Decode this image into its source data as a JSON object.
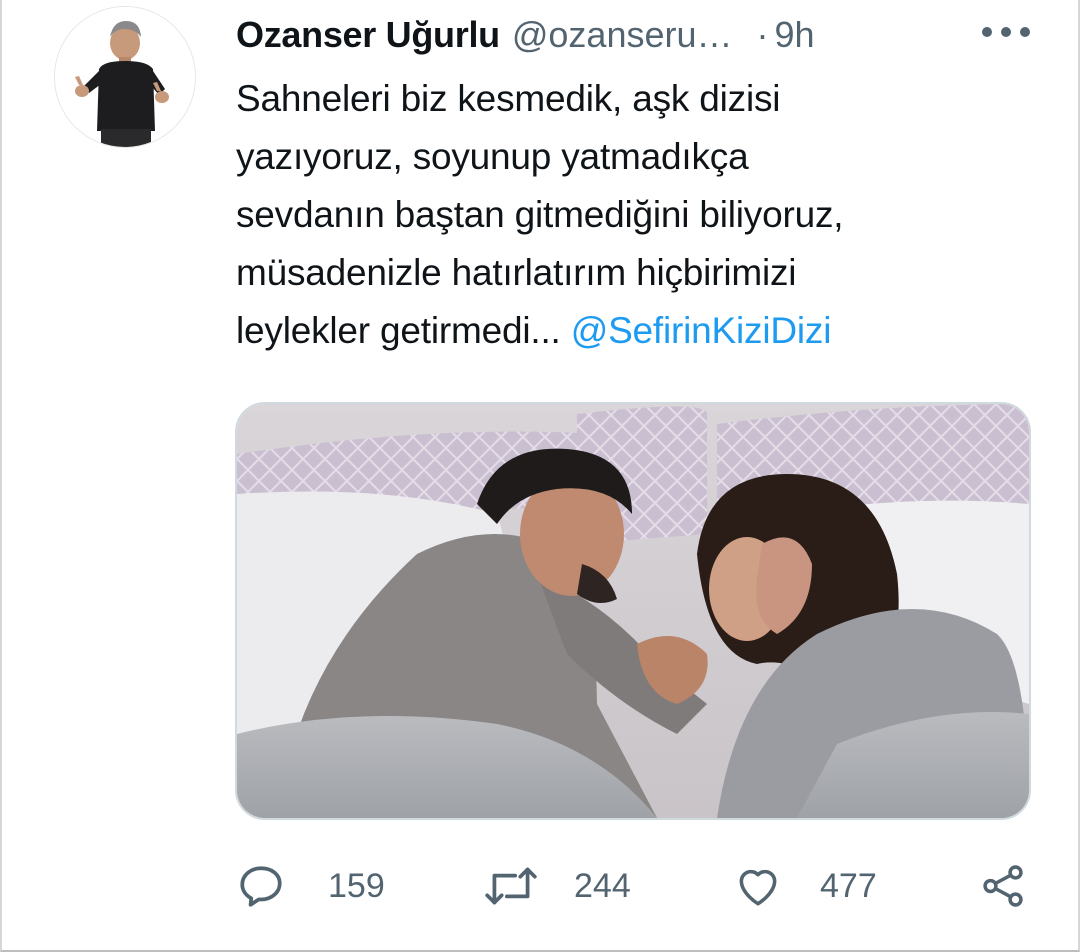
{
  "tweet": {
    "author_name": "Ozanser Uğurlu",
    "author_handle": "@ozanseru…",
    "separator": "·",
    "time": "9h",
    "more_icon": "more-horizontal-icon",
    "text_lines": [
      "Sahneleri biz kesmedik, aşk dizisi",
      "yazıyoruz, soyunup yatmadıkça",
      "sevdanın baştan gitmediğini biliyoruz,",
      "müsadenizle hatırlatırım hiçbirimizi"
    ],
    "last_line_text": "leylekler getirmedi...",
    "mention": "@SefirinKiziDizi",
    "media_description_icon": "photo-couple-in-bed",
    "colors": {
      "link": "#1d9bf0",
      "secondary": "#536471",
      "primary": "#0f1419"
    }
  },
  "actions": {
    "reply": {
      "icon": "reply-icon",
      "count": "159"
    },
    "retweet": {
      "icon": "retweet-icon",
      "count": "244"
    },
    "like": {
      "icon": "heart-icon",
      "count": "477"
    },
    "share": {
      "icon": "share-icon"
    }
  }
}
